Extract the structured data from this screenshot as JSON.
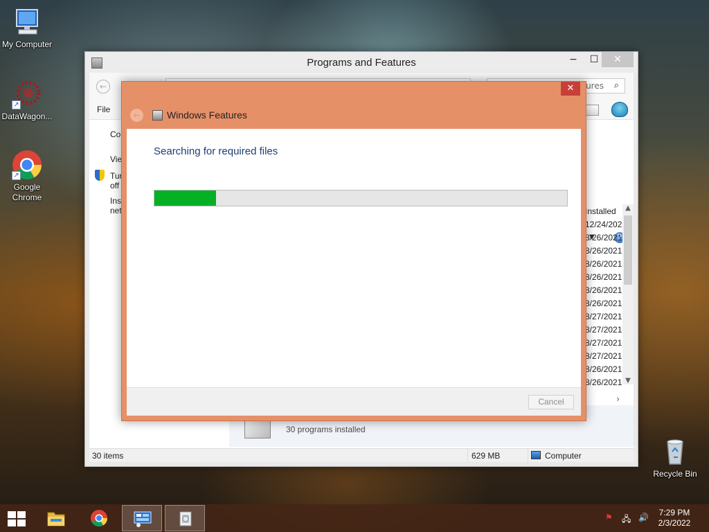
{
  "desktop": {
    "icons": [
      {
        "label": "My Computer"
      },
      {
        "label": "DataWagon..."
      },
      {
        "label": "Google Chrome"
      },
      {
        "label": "Recycle Bin"
      }
    ]
  },
  "programs_window": {
    "title": "Programs and Features",
    "search_placeholder": "ures",
    "menu_file": "File",
    "left_pane": {
      "items": [
        "Co",
        "Vie",
        "Tur",
        "off",
        "Inst",
        "net"
      ]
    },
    "column_header": "Installed",
    "installed_dates": [
      "12/24/202",
      "8/26/2021",
      "8/26/2021",
      "8/26/2021",
      "8/26/2021",
      "8/26/2021",
      "8/26/2021",
      "8/27/2021",
      "8/27/2021",
      "8/27/2021",
      "8/27/2021",
      "8/26/2021",
      "8/26/2021"
    ],
    "details": "30 programs installed",
    "status": {
      "items": "30 items",
      "size": "629 MB",
      "location": "Computer"
    }
  },
  "windows_features_dialog": {
    "title": "Windows Features",
    "heading": "Searching for required files",
    "progress_fraction": 0.15,
    "cancel_label": "Cancel",
    "close_glyph": "✕"
  },
  "taskbar": {
    "time": "7:29 PM",
    "date": "2/3/2022"
  },
  "colors": {
    "dialog_accent": "#e69068",
    "progress_fill": "#06b025"
  }
}
